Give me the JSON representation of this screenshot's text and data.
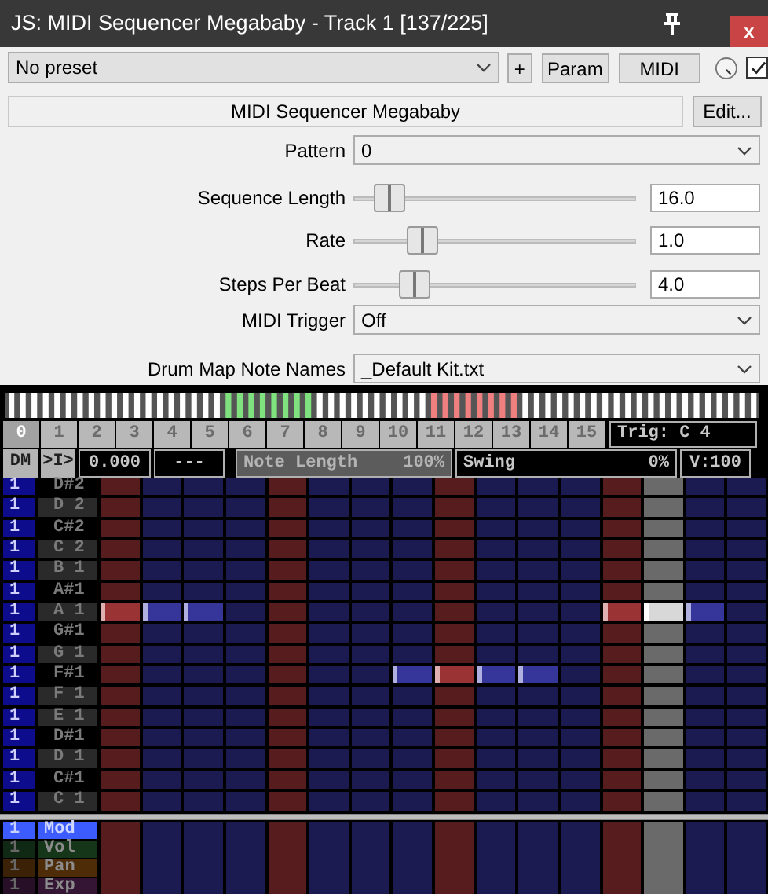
{
  "window": {
    "title": "JS: MIDI Sequencer Megababy - Track 1 [137/225]",
    "close": "x"
  },
  "toolbar": {
    "preset": "No preset",
    "buttons": [
      "+",
      "Param",
      "MIDI"
    ],
    "enabled": true
  },
  "plugin_name": "MIDI Sequencer Megababy",
  "edit_button": "Edit...",
  "params": [
    {
      "kind": "dropdown",
      "label": "Pattern",
      "value": "0"
    },
    {
      "kind": "slider",
      "label": "Sequence Length",
      "level": 0.08,
      "value": "16.0"
    },
    {
      "kind": "slider",
      "label": "Rate",
      "level": 0.21,
      "value": "1.0"
    },
    {
      "kind": "slider",
      "label": "Steps Per Beat",
      "level": 0.18,
      "value": "4.0"
    },
    {
      "kind": "dropdown",
      "label": "MIDI Trigger",
      "value": "Off"
    },
    {
      "kind": "dropdown",
      "label": "Drum Map Note Names",
      "value": "_Default Kit.txt"
    }
  ],
  "sequencer": {
    "steps": [
      {
        "label": "0",
        "selected": true
      },
      {
        "label": "1",
        "selected": false
      },
      {
        "label": "2",
        "selected": false
      },
      {
        "label": "3",
        "selected": false
      },
      {
        "label": "4",
        "selected": false
      },
      {
        "label": "5",
        "selected": false
      },
      {
        "label": "6",
        "selected": false
      },
      {
        "label": "7",
        "selected": false
      },
      {
        "label": "8",
        "selected": false
      },
      {
        "label": "9",
        "selected": false
      },
      {
        "label": "10",
        "selected": false
      },
      {
        "label": "11",
        "selected": false
      },
      {
        "label": "12",
        "selected": false
      },
      {
        "label": "13",
        "selected": false
      },
      {
        "label": "14",
        "selected": false
      },
      {
        "label": "15",
        "selected": false
      }
    ],
    "trigger": "Trig: C 4",
    "controls": [
      {
        "kind": "button",
        "text": "DM"
      },
      {
        "kind": "button",
        "text": ">I>"
      },
      {
        "kind": "field",
        "text": "0.000"
      },
      {
        "kind": "field",
        "text": "---"
      },
      {
        "kind": "slider",
        "label": "Note Length",
        "value": "100%",
        "level": 1
      },
      {
        "kind": "slider",
        "label": "Swing",
        "value": "0%",
        "level": 0
      },
      {
        "kind": "field",
        "text": "V:100"
      }
    ],
    "columns": [
      {
        "beat": true,
        "playing": false
      },
      {
        "beat": false,
        "playing": false
      },
      {
        "beat": false,
        "playing": false
      },
      {
        "beat": false,
        "playing": false
      },
      {
        "beat": true,
        "playing": false
      },
      {
        "beat": false,
        "playing": false
      },
      {
        "beat": false,
        "playing": false
      },
      {
        "beat": false,
        "playing": false
      },
      {
        "beat": true,
        "playing": false
      },
      {
        "beat": false,
        "playing": false
      },
      {
        "beat": false,
        "playing": false
      },
      {
        "beat": false,
        "playing": false
      },
      {
        "beat": true,
        "playing": false
      },
      {
        "beat": false,
        "playing": true
      },
      {
        "beat": false,
        "playing": false
      },
      {
        "beat": false,
        "playing": false
      }
    ],
    "rows": [
      {
        "channel": "1",
        "note": "D#2",
        "sharp": true,
        "cells": [
          false,
          false,
          false,
          false,
          false,
          false,
          false,
          false,
          false,
          false,
          false,
          false,
          false,
          false,
          false,
          false
        ]
      },
      {
        "channel": "1",
        "note": "D 2",
        "sharp": false,
        "cells": [
          false,
          false,
          false,
          false,
          false,
          false,
          false,
          false,
          false,
          false,
          false,
          false,
          false,
          false,
          false,
          false
        ]
      },
      {
        "channel": "1",
        "note": "C#2",
        "sharp": true,
        "cells": [
          false,
          false,
          false,
          false,
          false,
          false,
          false,
          false,
          false,
          false,
          false,
          false,
          false,
          false,
          false,
          false
        ]
      },
      {
        "channel": "1",
        "note": "C 2",
        "sharp": false,
        "cells": [
          false,
          false,
          false,
          false,
          false,
          false,
          false,
          false,
          false,
          false,
          false,
          false,
          false,
          false,
          false,
          false
        ]
      },
      {
        "channel": "1",
        "note": "B 1",
        "sharp": false,
        "cells": [
          false,
          false,
          false,
          false,
          false,
          false,
          false,
          false,
          false,
          false,
          false,
          false,
          false,
          false,
          false,
          false
        ]
      },
      {
        "channel": "1",
        "note": "A#1",
        "sharp": true,
        "cells": [
          false,
          false,
          false,
          false,
          false,
          false,
          false,
          false,
          false,
          false,
          false,
          false,
          false,
          false,
          false,
          false
        ]
      },
      {
        "channel": "1",
        "note": "A 1",
        "sharp": false,
        "cells": [
          true,
          true,
          true,
          false,
          false,
          false,
          false,
          false,
          false,
          false,
          false,
          false,
          true,
          true,
          true,
          false
        ]
      },
      {
        "channel": "1",
        "note": "G#1",
        "sharp": true,
        "cells": [
          false,
          false,
          false,
          false,
          false,
          false,
          false,
          false,
          false,
          false,
          false,
          false,
          false,
          false,
          false,
          false
        ]
      },
      {
        "channel": "1",
        "note": "G 1",
        "sharp": false,
        "cells": [
          false,
          false,
          false,
          false,
          false,
          false,
          false,
          false,
          false,
          false,
          false,
          false,
          false,
          false,
          false,
          false
        ]
      },
      {
        "channel": "1",
        "note": "F#1",
        "sharp": true,
        "cells": [
          false,
          false,
          false,
          false,
          false,
          false,
          false,
          true,
          true,
          true,
          true,
          false,
          false,
          false,
          false,
          false
        ]
      },
      {
        "channel": "1",
        "note": "F 1",
        "sharp": false,
        "cells": [
          false,
          false,
          false,
          false,
          false,
          false,
          false,
          false,
          false,
          false,
          false,
          false,
          false,
          false,
          false,
          false
        ]
      },
      {
        "channel": "1",
        "note": "E 1",
        "sharp": false,
        "cells": [
          false,
          false,
          false,
          false,
          false,
          false,
          false,
          false,
          false,
          false,
          false,
          false,
          false,
          false,
          false,
          false
        ]
      },
      {
        "channel": "1",
        "note": "D#1",
        "sharp": true,
        "cells": [
          false,
          false,
          false,
          false,
          false,
          false,
          false,
          false,
          false,
          false,
          false,
          false,
          false,
          false,
          false,
          false
        ]
      },
      {
        "channel": "1",
        "note": "D 1",
        "sharp": false,
        "cells": [
          false,
          false,
          false,
          false,
          false,
          false,
          false,
          false,
          false,
          false,
          false,
          false,
          false,
          false,
          false,
          false
        ]
      },
      {
        "channel": "1",
        "note": "C#1",
        "sharp": true,
        "cells": [
          false,
          false,
          false,
          false,
          false,
          false,
          false,
          false,
          false,
          false,
          false,
          false,
          false,
          false,
          false,
          false
        ]
      },
      {
        "channel": "1",
        "note": "C 1",
        "sharp": false,
        "cells": [
          false,
          false,
          false,
          false,
          false,
          false,
          false,
          false,
          false,
          false,
          false,
          false,
          false,
          false,
          false,
          false
        ]
      }
    ],
    "cc_rows": [
      {
        "channel": "1",
        "label": "Mod",
        "selected": true,
        "color": "#3c5cff"
      },
      {
        "channel": "1",
        "label": "Vol",
        "selected": false,
        "color": "#16361a"
      },
      {
        "channel": "1",
        "label": "Pan",
        "selected": false,
        "color": "#4e2c08"
      },
      {
        "channel": "1",
        "label": "Exp",
        "selected": false,
        "color": "#341634"
      }
    ]
  }
}
